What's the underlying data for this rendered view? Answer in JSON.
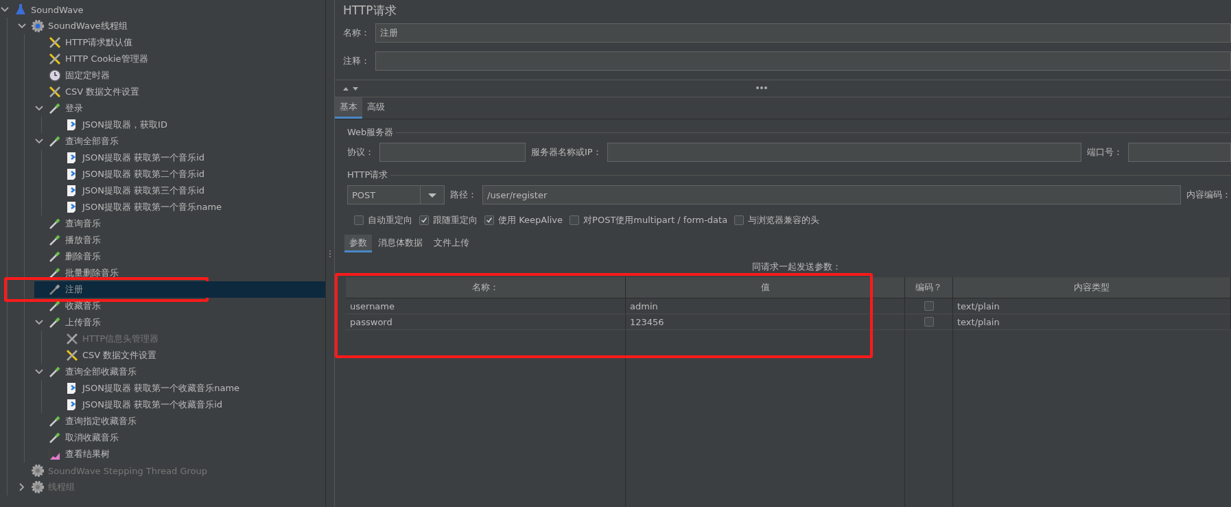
{
  "tree": [
    {
      "label": "SoundWave",
      "kind": "testplan",
      "expanded": true,
      "disabled": false,
      "selected": false,
      "children": [
        {
          "label": "SoundWave线程组",
          "kind": "threadgroup",
          "expanded": true,
          "disabled": false,
          "selected": false,
          "children": [
            {
              "label": "HTTP请求默认值",
              "kind": "config",
              "disabled": false,
              "selected": false
            },
            {
              "label": "HTTP Cookie管理器",
              "kind": "config",
              "disabled": false,
              "selected": false
            },
            {
              "label": "固定定时器",
              "kind": "timer",
              "disabled": false,
              "selected": false
            },
            {
              "label": "CSV 数据文件设置",
              "kind": "config",
              "disabled": false,
              "selected": false
            },
            {
              "label": "登录",
              "kind": "sampler",
              "expanded": true,
              "disabled": false,
              "selected": false,
              "children": [
                {
                  "label": "JSON提取器，获取ID",
                  "kind": "extractor",
                  "disabled": false,
                  "selected": false
                }
              ]
            },
            {
              "label": "查询全部音乐",
              "kind": "sampler",
              "expanded": true,
              "disabled": false,
              "selected": false,
              "children": [
                {
                  "label": "JSON提取器 获取第一个音乐id",
                  "kind": "extractor",
                  "disabled": false,
                  "selected": false
                },
                {
                  "label": "JSON提取器 获取第二个音乐id",
                  "kind": "extractor",
                  "disabled": false,
                  "selected": false
                },
                {
                  "label": "JSON提取器 获取第三个音乐id",
                  "kind": "extractor",
                  "disabled": false,
                  "selected": false
                },
                {
                  "label": "JSON提取器 获取第一个音乐name",
                  "kind": "extractor",
                  "disabled": false,
                  "selected": false
                }
              ]
            },
            {
              "label": "查询音乐",
              "kind": "sampler",
              "disabled": false,
              "selected": false
            },
            {
              "label": "播放音乐",
              "kind": "sampler",
              "disabled": false,
              "selected": false
            },
            {
              "label": "删除音乐",
              "kind": "sampler",
              "disabled": false,
              "selected": false
            },
            {
              "label": "批量删除音乐",
              "kind": "sampler",
              "disabled": false,
              "selected": false
            },
            {
              "label": "注册",
              "kind": "sampler",
              "disabled": true,
              "selected": true,
              "highlighted": true
            },
            {
              "label": "收藏音乐",
              "kind": "sampler",
              "disabled": false,
              "selected": false
            },
            {
              "label": "上传音乐",
              "kind": "sampler",
              "expanded": true,
              "disabled": false,
              "selected": false,
              "children": [
                {
                  "label": "HTTP信息头管理器",
                  "kind": "config",
                  "disabled": true,
                  "selected": false
                },
                {
                  "label": "CSV 数据文件设置",
                  "kind": "config",
                  "disabled": false,
                  "selected": false
                }
              ]
            },
            {
              "label": "查询全部收藏音乐",
              "kind": "sampler",
              "expanded": true,
              "disabled": false,
              "selected": false,
              "children": [
                {
                  "label": "JSON提取器 获取第一个收藏音乐name",
                  "kind": "extractor",
                  "disabled": false,
                  "selected": false
                },
                {
                  "label": "JSON提取器 获取第一个收藏音乐id",
                  "kind": "extractor",
                  "disabled": false,
                  "selected": false
                }
              ]
            },
            {
              "label": "查询指定收藏音乐",
              "kind": "sampler",
              "disabled": false,
              "selected": false
            },
            {
              "label": "取消收藏音乐",
              "kind": "sampler",
              "disabled": false,
              "selected": false
            },
            {
              "label": "查看结果树",
              "kind": "listener",
              "disabled": false,
              "selected": false
            }
          ]
        },
        {
          "label": "SoundWave Stepping Thread Group",
          "kind": "threadgroup",
          "disabled": true,
          "selected": false
        },
        {
          "label": "线程组",
          "kind": "threadgroup",
          "expanded": false,
          "disabled": true,
          "selected": false
        }
      ]
    }
  ],
  "panel": {
    "title": "HTTP请求",
    "name_label": "名称：",
    "name_value": "注册",
    "comment_label": "注释：",
    "tabs": [
      {
        "label": "基本",
        "selected": true
      },
      {
        "label": "高级",
        "selected": false
      }
    ],
    "web_server": {
      "legend": "Web服务器",
      "protocol_label": "协议：",
      "server_label": "服务器名称或IP：",
      "port_label": "端口号："
    },
    "http_request": {
      "legend": "HTTP请求",
      "method": "POST",
      "path_label": "路径：",
      "path_value": "/user/register",
      "encoding_label": "内容编码：",
      "options": [
        {
          "label": "自动重定向",
          "checked": false
        },
        {
          "label": "跟随重定向",
          "checked": true
        },
        {
          "label": "使用 KeepAlive",
          "checked": true
        },
        {
          "label": "对POST使用multipart / form-data",
          "checked": false
        },
        {
          "label": "与浏览器兼容的头",
          "checked": false
        }
      ]
    },
    "sub_tabs": [
      {
        "label": "参数",
        "selected": true
      },
      {
        "label": "消息体数据",
        "selected": false
      },
      {
        "label": "文件上传",
        "selected": false
      }
    ],
    "params": {
      "caption": "同请求一起发送参数：",
      "highlighted": true,
      "columns": [
        "名称：",
        "值",
        "编码？",
        "内容类型"
      ],
      "rows": [
        {
          "name": "username",
          "value": "admin",
          "encode": false,
          "content_type": "text/plain"
        },
        {
          "name": "password",
          "value": "123456",
          "encode": false,
          "content_type": "text/plain"
        }
      ]
    }
  }
}
